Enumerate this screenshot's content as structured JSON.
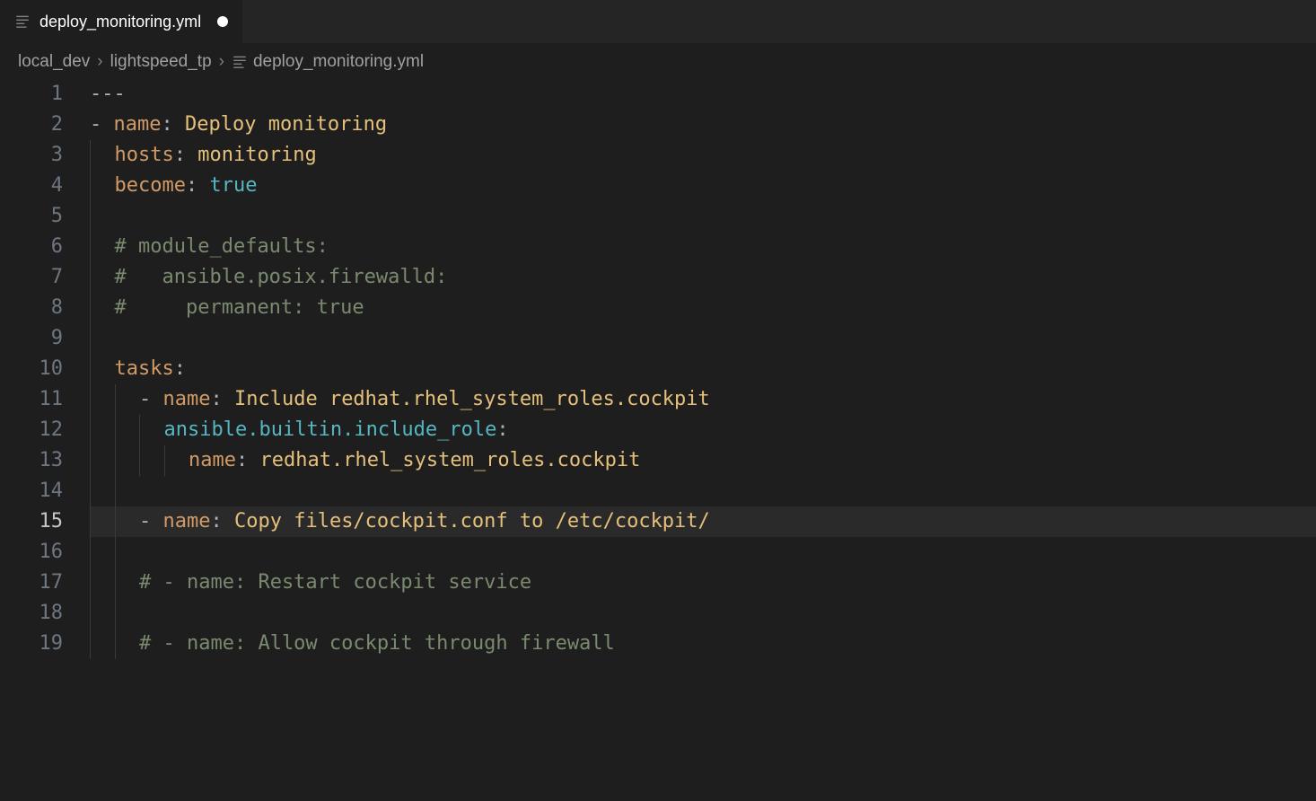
{
  "tab": {
    "label": "deploy_monitoring.yml",
    "modified": true
  },
  "breadcrumbs": {
    "items": [
      "local_dev",
      "lightspeed_tp",
      "deploy_monitoring.yml"
    ]
  },
  "editor": {
    "current_line": 15,
    "lines": [
      {
        "n": 1,
        "tokens": [
          {
            "cls": "tok-doc",
            "t": "---"
          }
        ]
      },
      {
        "n": 2,
        "tokens": [
          {
            "cls": "tok-dash",
            "t": "- "
          },
          {
            "cls": "tok-key",
            "t": "name"
          },
          {
            "cls": "tok-punct",
            "t": ": "
          },
          {
            "cls": "tok-string",
            "t": "Deploy monitoring"
          }
        ]
      },
      {
        "n": 3,
        "indent": 1,
        "tokens": [
          {
            "cls": "tok-key",
            "t": "hosts"
          },
          {
            "cls": "tok-punct",
            "t": ": "
          },
          {
            "cls": "tok-string",
            "t": "monitoring"
          }
        ]
      },
      {
        "n": 4,
        "indent": 1,
        "tokens": [
          {
            "cls": "tok-key",
            "t": "become"
          },
          {
            "cls": "tok-punct",
            "t": ": "
          },
          {
            "cls": "tok-bool",
            "t": "true"
          }
        ]
      },
      {
        "n": 5,
        "indent": 1,
        "tokens": []
      },
      {
        "n": 6,
        "indent": 1,
        "tokens": [
          {
            "cls": "tok-comment",
            "t": "# module_defaults:"
          }
        ]
      },
      {
        "n": 7,
        "indent": 1,
        "tokens": [
          {
            "cls": "tok-comment",
            "t": "#   ansible.posix.firewalld:"
          }
        ]
      },
      {
        "n": 8,
        "indent": 1,
        "tokens": [
          {
            "cls": "tok-comment",
            "t": "#     permanent: true"
          }
        ]
      },
      {
        "n": 9,
        "indent": 1,
        "tokens": []
      },
      {
        "n": 10,
        "indent": 1,
        "tokens": [
          {
            "cls": "tok-key",
            "t": "tasks"
          },
          {
            "cls": "tok-punct",
            "t": ":"
          }
        ]
      },
      {
        "n": 11,
        "indent": 2,
        "tokens": [
          {
            "cls": "tok-dash",
            "t": "- "
          },
          {
            "cls": "tok-key",
            "t": "name"
          },
          {
            "cls": "tok-punct",
            "t": ": "
          },
          {
            "cls": "tok-string",
            "t": "Include redhat.rhel_system_roles.cockpit"
          }
        ]
      },
      {
        "n": 12,
        "indent": 3,
        "tokens": [
          {
            "cls": "tok-func",
            "t": "ansible.builtin.include_role"
          },
          {
            "cls": "tok-punct",
            "t": ":"
          }
        ]
      },
      {
        "n": 13,
        "indent": 4,
        "tokens": [
          {
            "cls": "tok-key",
            "t": "name"
          },
          {
            "cls": "tok-punct",
            "t": ": "
          },
          {
            "cls": "tok-string",
            "t": "redhat.rhel_system_roles.cockpit"
          }
        ]
      },
      {
        "n": 14,
        "indent": 2,
        "tokens": []
      },
      {
        "n": 15,
        "indent": 2,
        "tokens": [
          {
            "cls": "tok-dash",
            "t": "- "
          },
          {
            "cls": "tok-key",
            "t": "name"
          },
          {
            "cls": "tok-punct",
            "t": ": "
          },
          {
            "cls": "tok-string",
            "t": "Copy files/cockpit.conf to /etc/cockpit/"
          }
        ]
      },
      {
        "n": 16,
        "indent": 2,
        "tokens": []
      },
      {
        "n": 17,
        "indent": 2,
        "tokens": [
          {
            "cls": "tok-comment",
            "t": "# - name: Restart cockpit service"
          }
        ]
      },
      {
        "n": 18,
        "indent": 2,
        "tokens": []
      },
      {
        "n": 19,
        "indent": 2,
        "tokens": [
          {
            "cls": "tok-comment",
            "t": "# - name: Allow cockpit through firewall"
          }
        ]
      }
    ]
  }
}
